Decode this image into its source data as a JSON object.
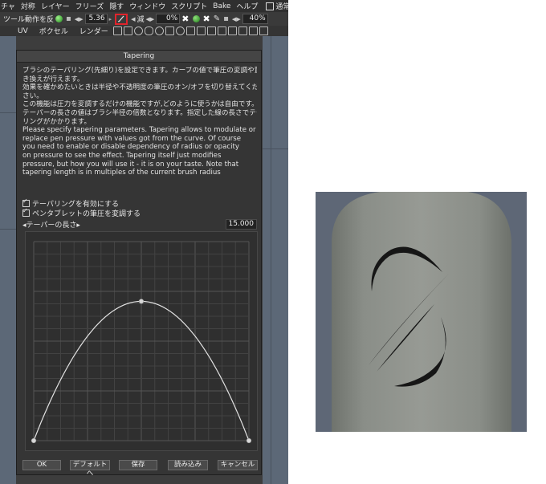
{
  "menubar": {
    "items": [
      "チャ",
      "対称",
      "レイヤー",
      "フリーズ",
      "隠す",
      "ウィンドウ",
      "スクリプト",
      "Bake",
      "ヘルプ"
    ],
    "normal_paint_label": "通常ペイン"
  },
  "toolbar": {
    "tool_action_label": "ツール動作を反",
    "radius_value": "5.36",
    "subtract_label": "減",
    "opacity_value": "0%",
    "zoom_value": "40%"
  },
  "modebar": {
    "tabs": [
      "UV",
      "ボクセル",
      "レンダー"
    ]
  },
  "dialog": {
    "title": "Tapering",
    "description": [
      "ブラシのテーパリング(先細り)を設定できます。カーブの値で筆圧の変調や置",
      "き換えが行えます。",
      "効果を確かめたいときは半径や不透明度の筆圧のオン/オフを切り替えてくだ",
      "さい。",
      "この機能は圧力を変調するだけの機能ですが,どのように使うかは自由です。",
      "テーパーの長さの値はブラシ半径の倍数となります。指定した線の長さでテーパ",
      "リングがかかります。",
      "Please specify tapering parameters. Tapering allows to modulate or",
      "replace pen pressure with values got from the curve. Of course",
      "you need to enable or disable dependency of radius or opacity",
      "on pressure to see the effect. Tapering itself just modifies",
      "pressure, but how you will use it - it is on your taste. Note that",
      "tapering length is in multiples of the current brush radius"
    ],
    "enable_tapering_label": "テーパリングを有効にする",
    "modulate_pressure_label": "ペンタブレットの筆圧を変調する",
    "taper_length_label": "◂テーパーの長さ▸",
    "taper_length_value": "15.000",
    "buttons": {
      "ok": "OK",
      "default": "デフォルトへ",
      "save": "保存",
      "load": "読み込み",
      "cancel": "キャンセル"
    }
  },
  "curve": {
    "points": [
      [
        0,
        0
      ],
      [
        0.5,
        0.7
      ],
      [
        1,
        0
      ]
    ]
  },
  "colors": {
    "accent_highlight": "#e0242c",
    "viewport": "#5c6877",
    "render_background": "#5e6776",
    "model_surface": "#8e928c"
  }
}
